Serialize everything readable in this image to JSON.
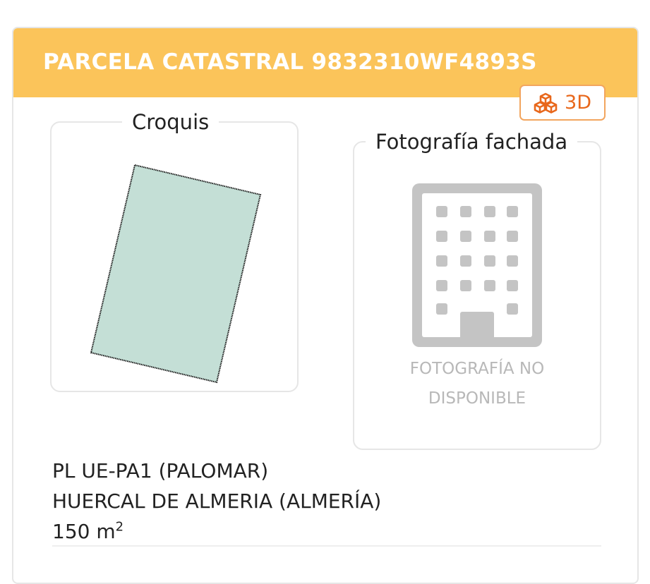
{
  "header": {
    "title": "PARCELA CATASTRAL 9832310WF4893S"
  },
  "button_3d": {
    "label": "3D",
    "icon": "cubes-icon",
    "color": "#e8671b"
  },
  "croquis": {
    "legend": "Croquis",
    "fill_color": "#c4dfd6"
  },
  "fachada": {
    "legend": "Fotografía fachada",
    "icon": "building-icon",
    "no_photo_line1": "FOTOGRAFÍA NO",
    "no_photo_line2": "DISPONIBLE"
  },
  "info": {
    "address_line1": "PL UE-PA1 (PALOMAR)",
    "address_line2": "HUERCAL DE ALMERIA (ALMERÍA)",
    "area_value": "150 m",
    "area_unit_sup": "2"
  },
  "colors": {
    "header_bg": "#fbc45a",
    "accent": "#e8671b"
  }
}
